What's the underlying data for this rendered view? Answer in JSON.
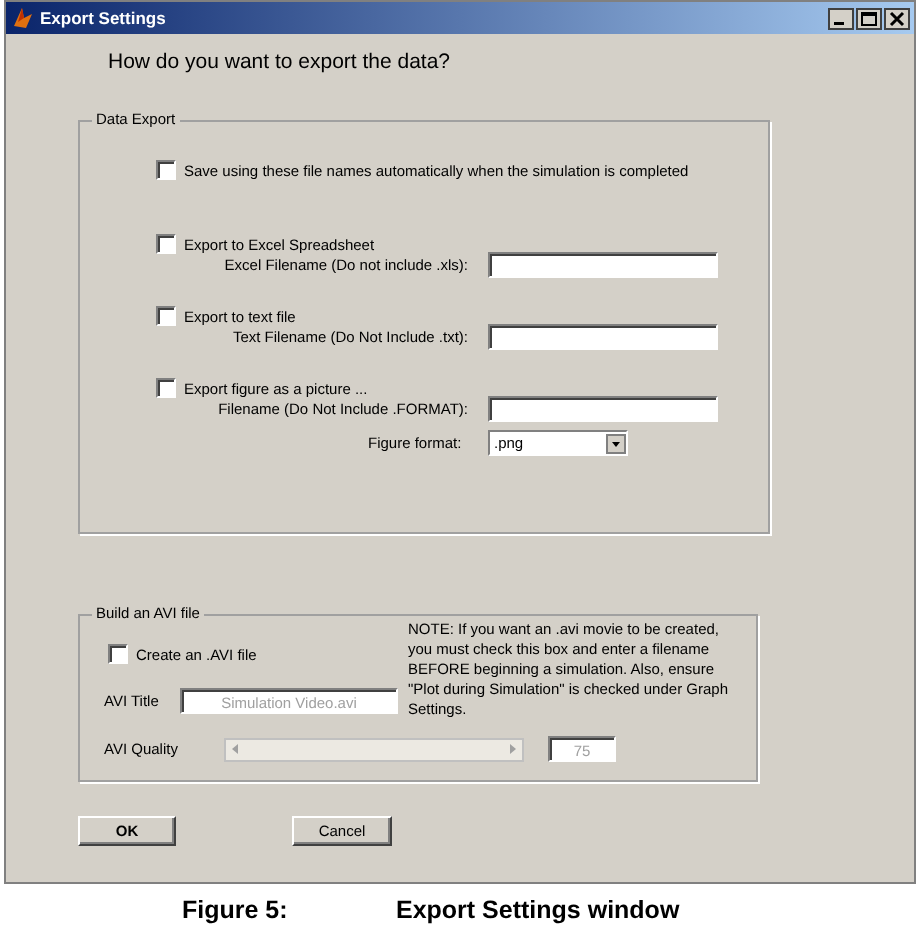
{
  "window": {
    "title": "Export Settings"
  },
  "prompt": "How do you want to export the data?",
  "data_export": {
    "title": "Data Export",
    "auto_save": {
      "label": "Save using these file names automatically when the simulation is completed",
      "checked": false
    },
    "options": [
      {
        "label": "Export to Excel Spreadsheet",
        "checked": false,
        "field_label": "Excel Filename (Do not include .xls):"
      },
      {
        "label": "Export to text file",
        "checked": false,
        "field_label": "Text Filename (Do Not Include .txt):"
      },
      {
        "label": "Export figure as a picture ...",
        "checked": false,
        "field_label": "Filename (Do Not Include .FORMAT):"
      }
    ],
    "figure_format": {
      "label": "Figure format:",
      "value": ".png"
    }
  },
  "avi": {
    "title": "Build an AVI file",
    "create": {
      "label": "Create an .AVI file",
      "checked": false
    },
    "note": "NOTE: If you want an .avi movie to be created, you must check this box and enter a filename BEFORE beginning a simulation. Also, ensure \"Plot during Simulation\" is checked under Graph Settings.",
    "title_label": "AVI Title",
    "title_field": {
      "value": "Simulation Video.avi",
      "disabled": true
    },
    "quality_label": "AVI Quality",
    "quality_slider": {
      "disabled": true
    },
    "quality_field": {
      "value": "75",
      "disabled": true
    }
  },
  "buttons": [
    {
      "label": "OK",
      "default": true
    },
    {
      "label": "Cancel",
      "default": false
    }
  ],
  "caption": {
    "number": "Figure 5:",
    "text": "Export Settings window"
  }
}
